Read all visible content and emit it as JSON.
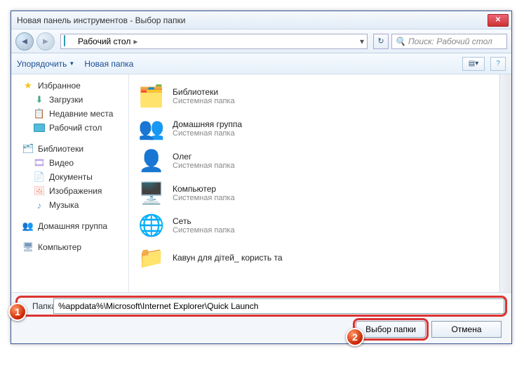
{
  "window": {
    "title": "Новая панель инструментов - Выбор папки"
  },
  "nav": {
    "location": "Рабочий стол",
    "arrow": "▸",
    "search_placeholder": "Поиск: Рабочий стол"
  },
  "toolbar": {
    "organize": "Упорядочить",
    "newfolder": "Новая папка"
  },
  "sidebar": {
    "favorites": "Избранное",
    "fav_items": [
      "Загрузки",
      "Недавние места",
      "Рабочий стол"
    ],
    "libraries": "Библиотеки",
    "lib_items": [
      "Видео",
      "Документы",
      "Изображения",
      "Музыка"
    ],
    "homegroup": "Домашняя группа",
    "computer": "Компьютер"
  },
  "content": {
    "items": [
      {
        "name": "Библиотеки",
        "sub": "Системная папка",
        "icon": "libraries"
      },
      {
        "name": "Домашняя группа",
        "sub": "Системная папка",
        "icon": "homegroup"
      },
      {
        "name": "Олег",
        "sub": "Системная папка",
        "icon": "user"
      },
      {
        "name": "Компьютер",
        "sub": "Системная папка",
        "icon": "computer"
      },
      {
        "name": "Сеть",
        "sub": "Системная папка",
        "icon": "network"
      },
      {
        "name": "Кавун для дітей_ користь та",
        "sub": "",
        "icon": "folder"
      }
    ]
  },
  "footer": {
    "folder_label": "Папка:",
    "folder_value": "%appdata%\\Microsoft\\Internet Explorer\\Quick Launch",
    "select_btn": "Выбор папки",
    "cancel_btn": "Отмена"
  },
  "annotations": {
    "badge1": "1",
    "badge2": "2"
  }
}
